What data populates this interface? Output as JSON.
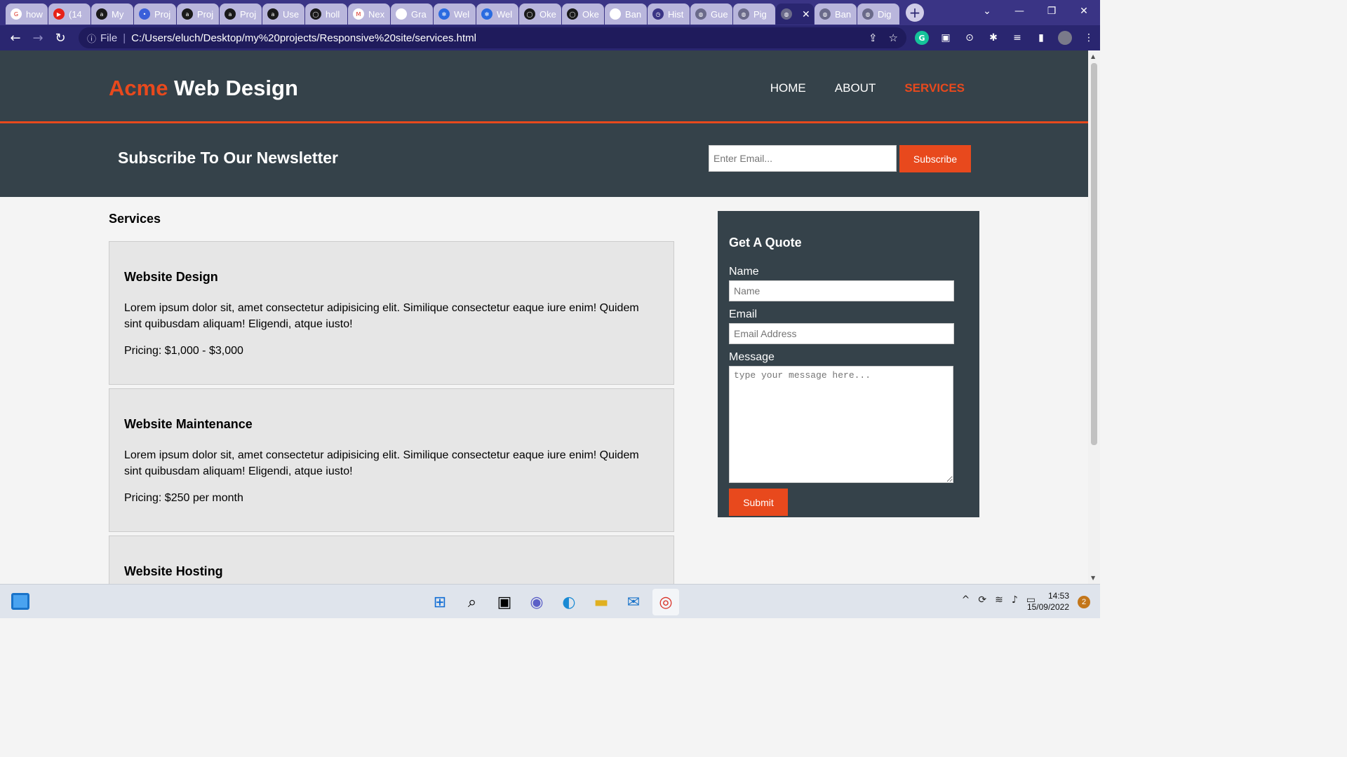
{
  "browser": {
    "tabs": [
      {
        "label": "how",
        "icon": "google-icon"
      },
      {
        "label": "(14",
        "icon": "youtube-icon"
      },
      {
        "label": "My",
        "icon": "alx-icon"
      },
      {
        "label": "Proj",
        "icon": "dot-icon"
      },
      {
        "label": "Proj",
        "icon": "alx-icon"
      },
      {
        "label": "Proj",
        "icon": "alx-icon"
      },
      {
        "label": "Use",
        "icon": "alx-icon"
      },
      {
        "label": "holl",
        "icon": "github-icon"
      },
      {
        "label": "Nex",
        "icon": "gmail-icon"
      },
      {
        "label": "Gra",
        "icon": "n-icon"
      },
      {
        "label": "Wel",
        "icon": "replit-icon"
      },
      {
        "label": "Wel",
        "icon": "replit-icon"
      },
      {
        "label": "Oke",
        "icon": "github-icon"
      },
      {
        "label": "Oke",
        "icon": "github-icon"
      },
      {
        "label": "Ban",
        "icon": "j-icon"
      },
      {
        "label": "Hist",
        "icon": "history-icon"
      },
      {
        "label": "Gue",
        "icon": "globe-icon"
      },
      {
        "label": "Pig",
        "icon": "globe-icon"
      },
      {
        "label": "",
        "icon": "globe-icon",
        "active": true
      },
      {
        "label": "Ban",
        "icon": "globe-icon"
      },
      {
        "label": "Dig",
        "icon": "globe-icon"
      }
    ],
    "address": {
      "scheme_label": "File",
      "url": "C:/Users/eluch/Desktop/my%20projects/Responsive%20site/services.html"
    }
  },
  "site": {
    "brand_highlight": "Acme",
    "brand_rest": " Web Design",
    "nav": [
      {
        "label": "HOME",
        "current": false
      },
      {
        "label": "ABOUT",
        "current": false
      },
      {
        "label": "SERVICES",
        "current": true
      }
    ],
    "newsletter": {
      "title": "Subscribe To Our Newsletter",
      "email_placeholder": "Enter Email...",
      "button": "Subscribe"
    },
    "services_title": "Services",
    "services": [
      {
        "title": "Website Design",
        "body": "Lorem ipsum dolor sit, amet consectetur adipisicing elit. Similique consectetur eaque iure enim! Quidem sint quibusdam aliquam! Eligendi, atque iusto!",
        "price": "Pricing: $1,000 - $3,000"
      },
      {
        "title": "Website Maintenance",
        "body": "Lorem ipsum dolor sit, amet consectetur adipisicing elit. Similique consectetur eaque iure enim! Quidem sint quibusdam aliquam! Eligendi, atque iusto!",
        "price": "Pricing: $250 per month"
      },
      {
        "title": "Website Hosting",
        "body": "",
        "price": ""
      }
    ],
    "quote": {
      "title": "Get A Quote",
      "name_label": "Name",
      "name_placeholder": "Name",
      "email_label": "Email",
      "email_placeholder": "Email Address",
      "message_label": "Message",
      "message_placeholder": "type your message here...",
      "submit": "Submit"
    }
  },
  "taskbar": {
    "time": "14:53",
    "date": "15/09/2022",
    "notifications": "2"
  },
  "colors": {
    "brand_accent": "#e8491d",
    "header_bg": "#35424a",
    "tabbar_bg": "#3a3485"
  }
}
